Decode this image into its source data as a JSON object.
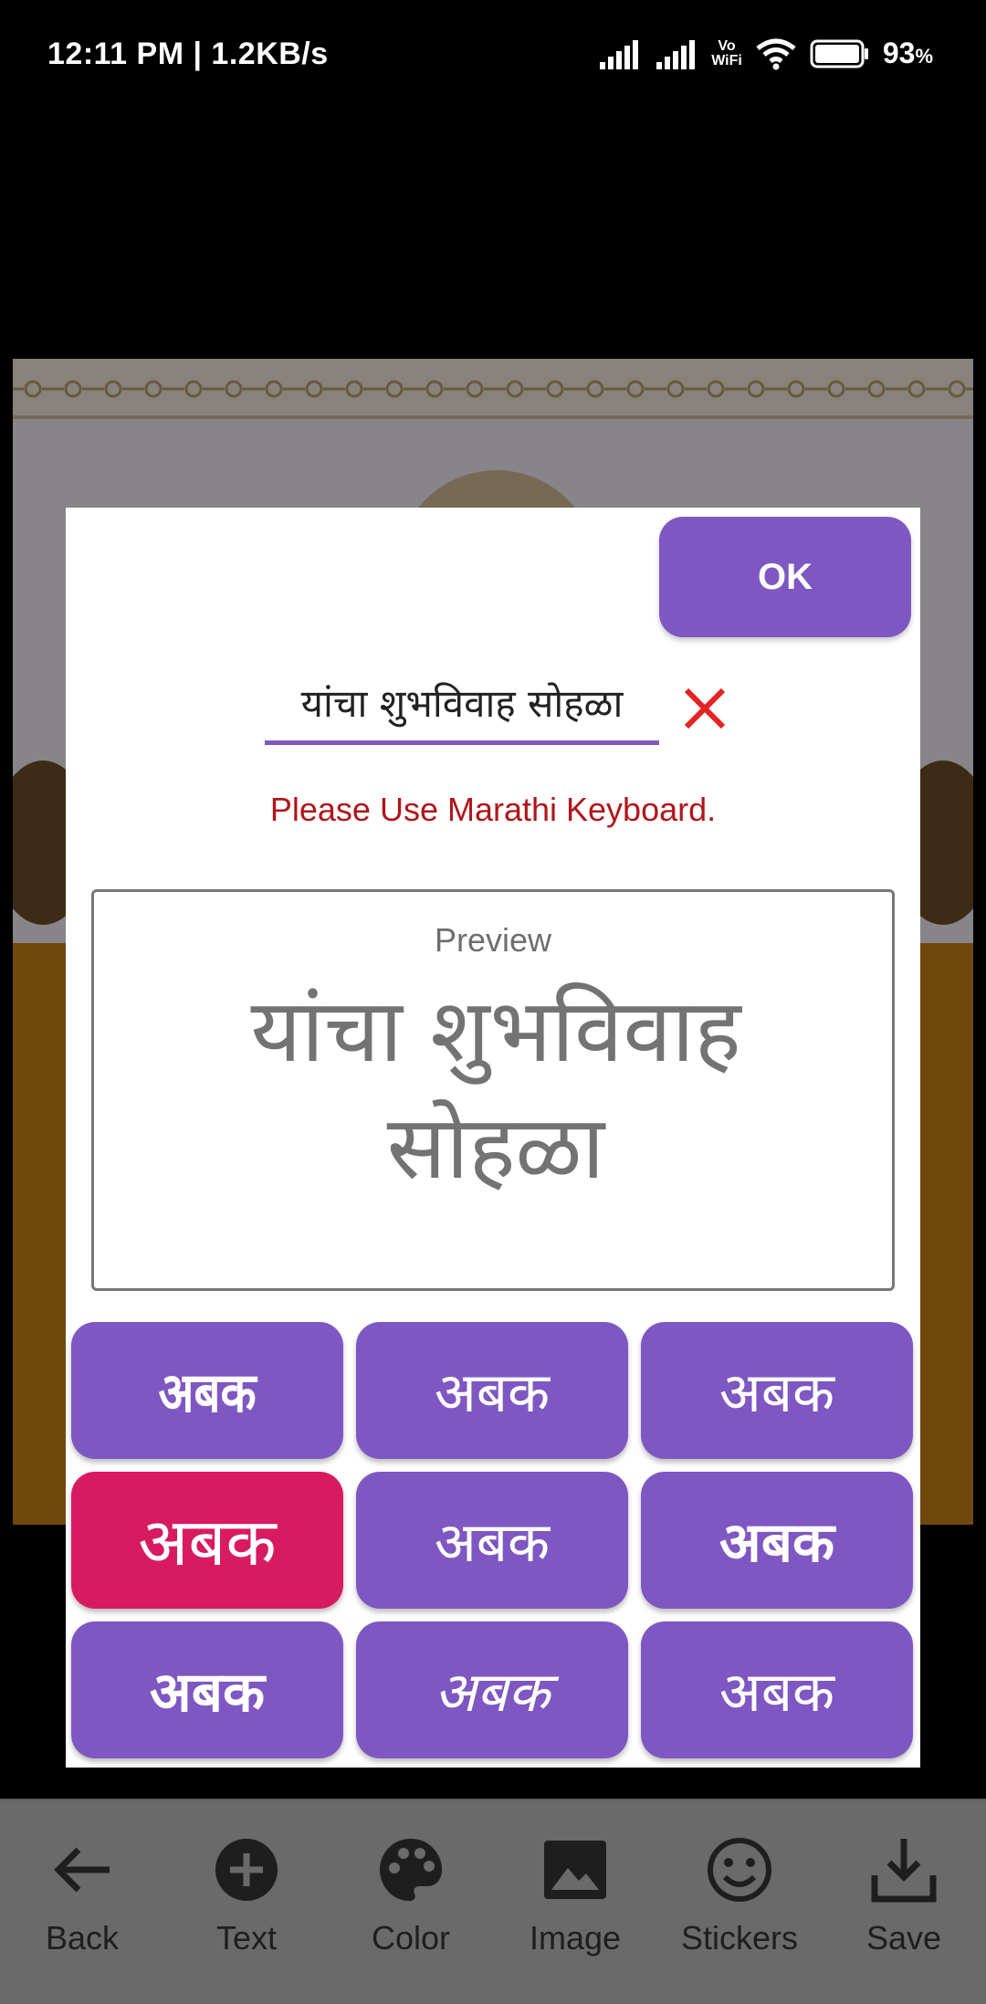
{
  "status_bar": {
    "time": "12:11 PM | 1.2KB/s",
    "vowifi_top": "Vo",
    "vowifi_bottom": "WiFi",
    "battery": "93",
    "battery_unit": "%"
  },
  "dialog": {
    "ok_label": "OK",
    "input_value": "यांचा शुभविवाह सोहळा",
    "warning": "Please Use Marathi Keyboard.",
    "preview_label": "Preview",
    "preview_text": "यांचा शुभविवाह सोहळा",
    "font_tiles": [
      "अबक",
      "अबक",
      "अबक",
      "अबक",
      "अबक",
      "अबक",
      "अबक",
      "अबक",
      "अबक"
    ],
    "selected_font_index": 3,
    "accent_color": "#7e57c2",
    "selected_color": "#d81b60",
    "warning_color": "#b0161a"
  },
  "toolbar": {
    "items": [
      {
        "label": "Back",
        "icon": "back-arrow-icon"
      },
      {
        "label": "Text",
        "icon": "add-circle-icon"
      },
      {
        "label": "Color",
        "icon": "palette-icon"
      },
      {
        "label": "Image",
        "icon": "image-icon"
      },
      {
        "label": "Stickers",
        "icon": "smiley-icon"
      },
      {
        "label": "Save",
        "icon": "download-icon"
      }
    ]
  }
}
